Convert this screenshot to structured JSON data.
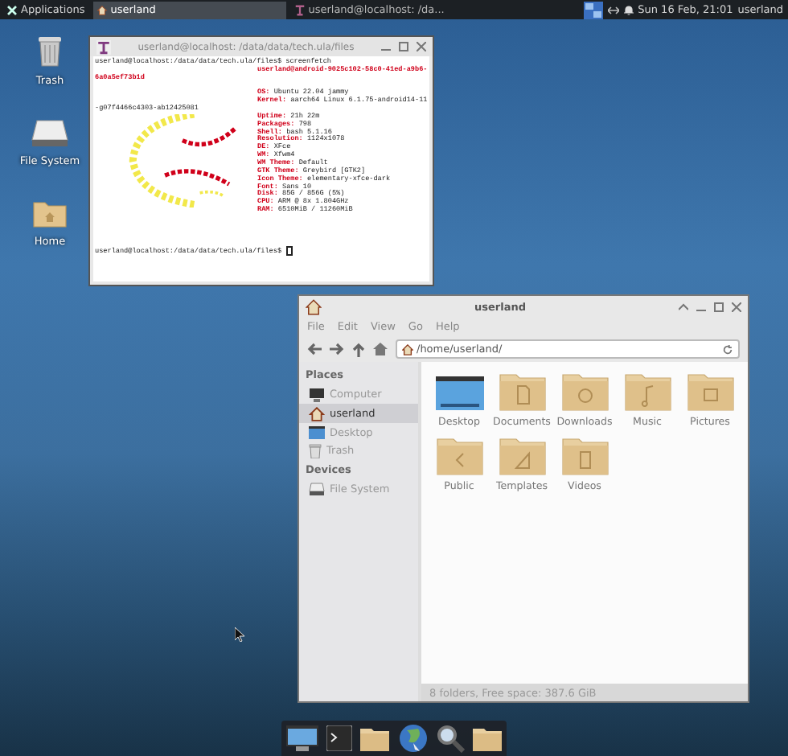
{
  "panel": {
    "menu": "Applications",
    "tasks": [
      {
        "label": "userland",
        "kind": "files",
        "selected": true
      },
      {
        "label": "userland@localhost: /da...",
        "kind": "terminal",
        "selected": false
      }
    ],
    "clock": "Sun 16 Feb, 21:01",
    "user": "userland"
  },
  "desktop_icons": [
    {
      "label": "Trash",
      "kind": "trash"
    },
    {
      "label": "File System",
      "kind": "drive"
    },
    {
      "label": "Home",
      "kind": "home"
    }
  ],
  "terminal": {
    "title": "userland@localhost: /data/data/tech.ula/files",
    "lines": [
      {
        "kind": "prompt",
        "text": "userland@localhost:/data/data/tech.ula/files$ screenfetch"
      },
      {
        "kind": "host",
        "text": "userland@android-9025c102-58c0-41ed-a9b6-"
      },
      {
        "kind": "wrap",
        "accent": true,
        "text": "6a0a5ef73b1d"
      },
      {
        "kind": "blank"
      },
      {
        "kind": "info",
        "key": "OS:",
        "value": "Ubuntu 22.04 jammy"
      },
      {
        "kind": "info",
        "key": "Kernel:",
        "value": "aarch64 Linux 6.1.75-android14-11"
      },
      {
        "kind": "wrap",
        "accent": false,
        "text": "-g07f4466c4303-ab12425081"
      },
      {
        "kind": "info",
        "key": "Uptime:",
        "value": "21h 22m"
      },
      {
        "kind": "info",
        "key": "Packages:",
        "value": "798"
      },
      {
        "kind": "info",
        "key": "Shell:",
        "value": "bash 5.1.16"
      },
      {
        "kind": "info",
        "key": "Resolution:",
        "value": "1124x1078"
      },
      {
        "kind": "info",
        "key": "DE:",
        "value": "XFce"
      },
      {
        "kind": "info",
        "key": "WM:",
        "value": "Xfwm4"
      },
      {
        "kind": "info",
        "key": "WM Theme:",
        "value": "Default"
      },
      {
        "kind": "info",
        "key": "GTK Theme:",
        "value": "Greybird [GTK2]"
      },
      {
        "kind": "info",
        "key": "Icon Theme:",
        "value": "elementary-xfce-dark"
      },
      {
        "kind": "info",
        "key": "Font:",
        "value": "Sans 10"
      },
      {
        "kind": "info",
        "key": "Disk:",
        "value": "85G / 856G (5%)"
      },
      {
        "kind": "info",
        "key": "CPU:",
        "value": "ARM @ 8x 1.804GHz"
      },
      {
        "kind": "info",
        "key": "RAM:",
        "value": "6510MiB / 11260MiB"
      },
      {
        "kind": "blank"
      },
      {
        "kind": "blank"
      },
      {
        "kind": "blank"
      },
      {
        "kind": "blank"
      },
      {
        "kind": "prompt",
        "text": "userland@localhost:/data/data/tech.ula/files$ ",
        "cursor": true
      }
    ]
  },
  "file_manager": {
    "title": "userland",
    "menu": [
      "File",
      "Edit",
      "View",
      "Go",
      "Help"
    ],
    "location": "/home/userland/",
    "sidebar": [
      {
        "heading": "Places",
        "items": [
          {
            "label": "Computer",
            "kind": "computer",
            "selected": false
          },
          {
            "label": "userland",
            "kind": "home",
            "selected": true
          },
          {
            "label": "Desktop",
            "kind": "desktop",
            "selected": false
          },
          {
            "label": "Trash",
            "kind": "trash",
            "selected": false
          }
        ]
      },
      {
        "heading": "Devices",
        "items": [
          {
            "label": "File System",
            "kind": "drive",
            "selected": false
          }
        ]
      }
    ],
    "folders": [
      {
        "label": "Desktop",
        "kind": "desktop"
      },
      {
        "label": "Documents",
        "kind": "document"
      },
      {
        "label": "Downloads",
        "kind": "download"
      },
      {
        "label": "Music",
        "kind": "music"
      },
      {
        "label": "Pictures",
        "kind": "picture"
      },
      {
        "label": "Public",
        "kind": "share"
      },
      {
        "label": "Templates",
        "kind": "template"
      },
      {
        "label": "Videos",
        "kind": "video"
      }
    ],
    "status": "8 folders, Free space: 387.6 GiB"
  },
  "dock": [
    {
      "kind": "screen"
    },
    {
      "kind": "terminal"
    },
    {
      "kind": "folder"
    },
    {
      "kind": "globe"
    },
    {
      "kind": "search"
    },
    {
      "kind": "folder"
    }
  ]
}
